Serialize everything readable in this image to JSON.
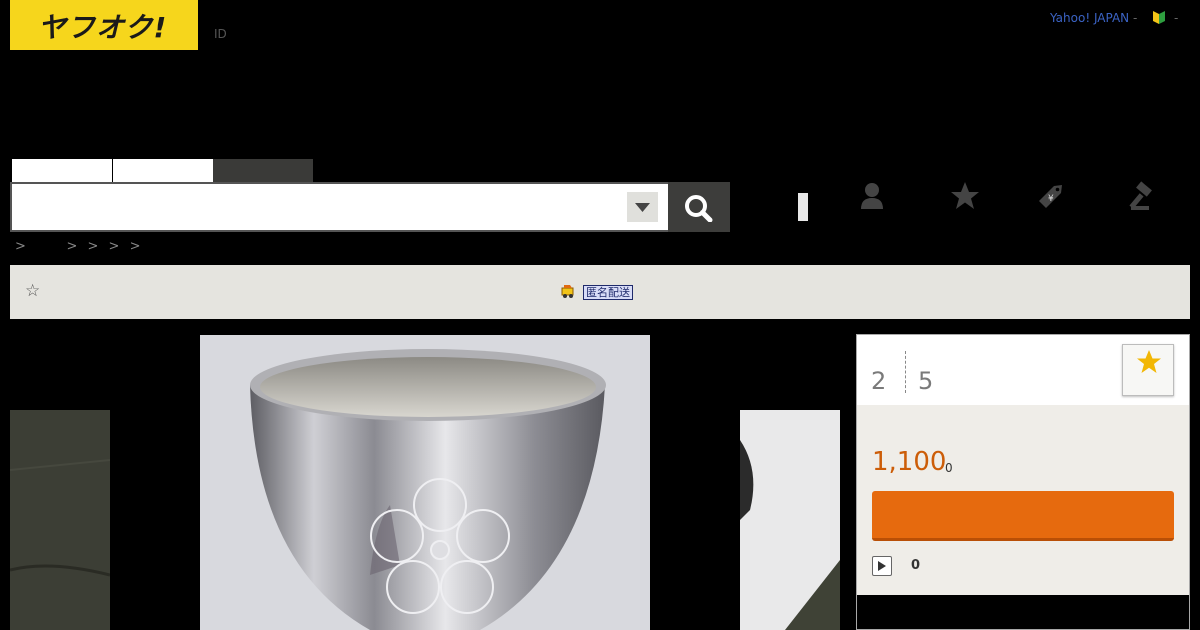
{
  "header": {
    "logo_text": "ヤフオク!",
    "id_label": "ID",
    "yahoo_link": "Yahoo! JAPAN",
    "separator": "-",
    "trailing_dash": "-",
    "beginner_icon": "beginner-mark-icon"
  },
  "search": {
    "tabs": [
      "",
      "",
      ""
    ],
    "placeholder": "",
    "dropdown_icon": "triangle-down-icon",
    "button_icon": "magnifier-icon"
  },
  "nav_icons": [
    "profile-icon",
    "star-icon",
    "tag-icon",
    "gavel-icon"
  ],
  "breadcrumb": {
    "items": [
      ">",
      ">",
      ">",
      ">",
      ">"
    ]
  },
  "notice": {
    "star": "☆",
    "shipping_icon": "delivery-icon",
    "anonymous_shipping": "匿名配送"
  },
  "item_panel": {
    "num_left": "2",
    "num_right": "5",
    "watch_icon": "star-icon",
    "price": "1,100",
    "price_suffix": "0",
    "bid_count": "0"
  },
  "colors": {
    "logo_yellow": "#f6d61c",
    "accent_orange": "#e66a0e",
    "price_orange": "#cc5d08",
    "link_blue": "#3b63c4",
    "star_gold": "#f2b705"
  }
}
